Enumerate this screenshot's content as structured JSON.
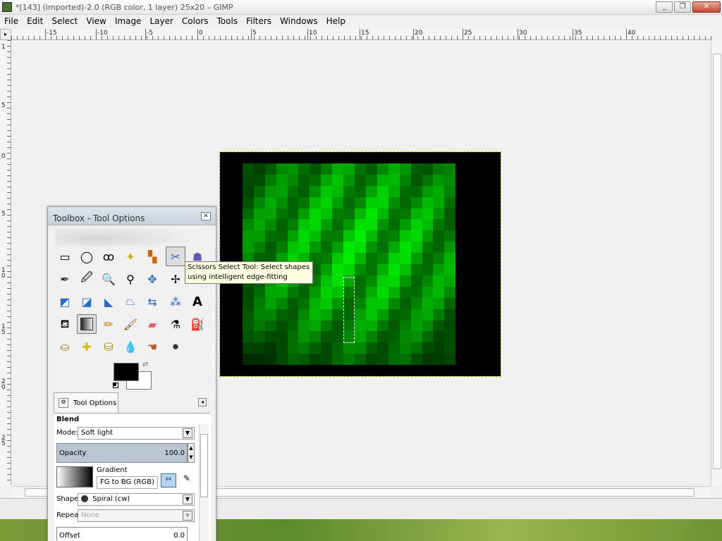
{
  "window": {
    "title": "*[143] (imported)-2.0 (RGB color, 1 layer) 25x20 – GIMP",
    "buttons": [
      "_",
      "❐",
      "✕"
    ]
  },
  "menu": [
    "File",
    "Edit",
    "Select",
    "View",
    "Image",
    "Layer",
    "Colors",
    "Tools",
    "Filters",
    "Windows",
    "Help"
  ],
  "hruler_labels": [
    "-15",
    "-10",
    "-5",
    "0",
    "5",
    "10",
    "15",
    "20",
    "25",
    "30",
    "35",
    "40"
  ],
  "vruler_labels": [
    "1",
    "5",
    "0",
    "5",
    "1 0",
    "1 5",
    "2 0",
    "2 5"
  ],
  "toolbox": {
    "title": "Toolbox - Tool Options",
    "tooltip": "Scissors Select Tool: Select shapes using intelligent edge-fitting",
    "tab_label": "Tool Options",
    "options": {
      "section": "Blend",
      "mode_label": "Mode:",
      "mode_value": "Soft light",
      "opacity_label": "Opacity",
      "opacity_value": "100.0",
      "gradient_label": "Gradient",
      "gradient_value": "FG to BG (RGB)",
      "shape_label": "Shape:",
      "shape_value": "Spiral (cw)",
      "repeat_label": "Repeat:",
      "repeat_value": "None",
      "offset_label": "Offset",
      "offset_value": "0.0"
    }
  },
  "colors": {
    "fg": "#000000",
    "bg": "#ffffff",
    "canvas_bg": "#f0f0f0"
  },
  "image": {
    "cols": 25,
    "rows": 20
  }
}
